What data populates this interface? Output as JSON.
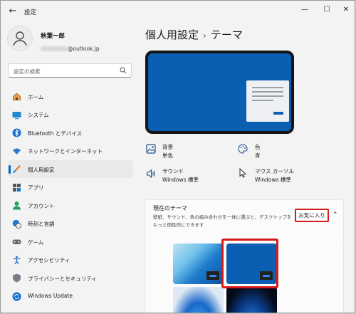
{
  "window": {
    "title": "設定"
  },
  "profile": {
    "name": "秋葉一郎",
    "email_visible": "@outlook.jp"
  },
  "search": {
    "placeholder": "設定の検索"
  },
  "sidebar": {
    "items": [
      {
        "label": "ホーム",
        "icon": "home-icon"
      },
      {
        "label": "システム",
        "icon": "system-icon"
      },
      {
        "label": "Bluetooth とデバイス",
        "icon": "bluetooth-icon"
      },
      {
        "label": "ネットワークとインターネット",
        "icon": "network-icon"
      },
      {
        "label": "個人用設定",
        "icon": "personalization-icon",
        "active": true
      },
      {
        "label": "アプリ",
        "icon": "apps-icon"
      },
      {
        "label": "アカウント",
        "icon": "account-icon"
      },
      {
        "label": "時刻と言語",
        "icon": "time-language-icon"
      },
      {
        "label": "ゲーム",
        "icon": "gaming-icon"
      },
      {
        "label": "アクセシビリティ",
        "icon": "accessibility-icon"
      },
      {
        "label": "プライバシーとセキュリティ",
        "icon": "privacy-shield-icon"
      },
      {
        "label": "Windows Update",
        "icon": "windows-update-icon"
      }
    ]
  },
  "main": {
    "breadcrumb_parent": "個人用設定",
    "breadcrumb_sep": "›",
    "breadcrumb_current": "テーマ",
    "properties": [
      {
        "label": "背景",
        "value": "単色",
        "icon": "background-image-icon"
      },
      {
        "label": "色",
        "value": "青",
        "icon": "palette-icon"
      },
      {
        "label": "サウンド",
        "value": "Windows 標準",
        "icon": "speaker-icon"
      },
      {
        "label": "マウス カーソル",
        "value": "Windows 標準",
        "icon": "cursor-icon"
      }
    ],
    "current_theme": {
      "title": "現在のテーマ",
      "description": "壁紙、サウンド、色の組み合わせを一体に選ぶと、デスクトップをもっと個性的にできます",
      "favorites_button": "お気に入り"
    }
  },
  "colors": {
    "accent": "#0067c0",
    "preview_bg": "#0a5fb3",
    "highlight": "#d51a1a"
  }
}
